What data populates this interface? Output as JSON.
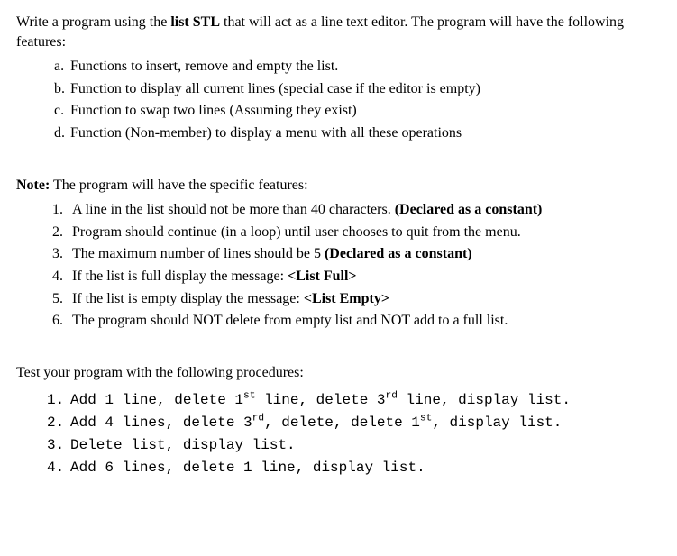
{
  "intro": {
    "pre": "Write a program using the ",
    "bold": "list STL",
    "post": " that will act as a line text editor. The program will have the following features:"
  },
  "features": {
    "a": {
      "marker": "a.",
      "text": "Functions to insert, remove and empty the list."
    },
    "b": {
      "marker": "b.",
      "text": "Function to display all current lines (special case if the editor is empty)"
    },
    "c": {
      "marker": "c.",
      "text": "Function to swap two lines (Assuming they exist)"
    },
    "d": {
      "marker": "d.",
      "text": "Function (Non-member) to display a menu with all these operations"
    }
  },
  "note_intro": {
    "bold": "Note:",
    "text": " The program will have the specific features:"
  },
  "notes": {
    "n1": {
      "marker": "1.",
      "pre": "A line in the list should not be more than 40 characters. ",
      "bold": "(Declared as a constant)"
    },
    "n2": {
      "marker": "2.",
      "text": "Program should continue (in a loop) until user chooses to quit from the menu."
    },
    "n3": {
      "marker": "3.",
      "pre": "The maximum number of lines should be 5 ",
      "bold": "(Declared as a constant)"
    },
    "n4": {
      "marker": "4.",
      "pre": "If the list is full display the message: ",
      "bold": "<List Full>"
    },
    "n5": {
      "marker": "5.",
      "pre": "If the list is empty display the message: ",
      "bold": "<List Empty>"
    },
    "n6": {
      "marker": "6.",
      "text": "The program should NOT delete from empty list and NOT add to a full list."
    }
  },
  "test_intro": "Test your program with the following procedures:",
  "tests": {
    "t1": {
      "marker": "1.",
      "p1": "Add 1 line, delete 1",
      "s1": "st",
      "p2": " line, delete 3",
      "s2": "rd",
      "p3": " line, display list."
    },
    "t2": {
      "marker": "2.",
      "p1": "Add 4 lines, delete 3",
      "s1": "rd",
      "p2": ", delete, delete 1",
      "s2": "st",
      "p3": ", display list."
    },
    "t3": {
      "marker": "3.",
      "text": "Delete list, display list."
    },
    "t4": {
      "marker": "4.",
      "text": "Add 6 lines, delete 1 line, display list."
    }
  }
}
